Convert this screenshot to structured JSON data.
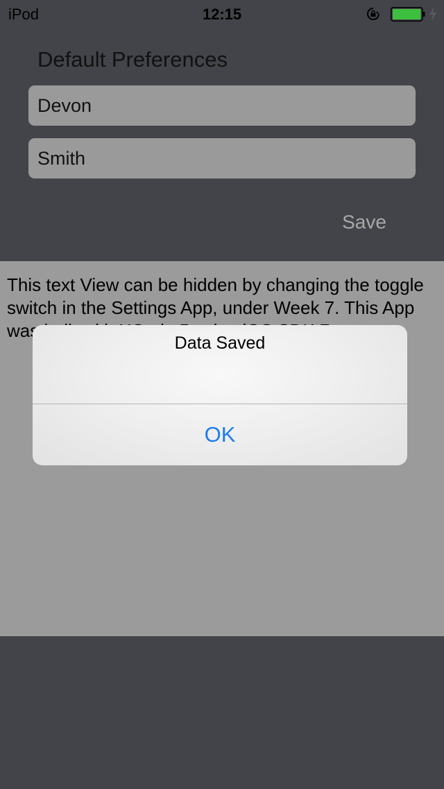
{
  "status_bar": {
    "carrier": "iPod",
    "time": "12:15",
    "battery_color": "#3fbf3f"
  },
  "prefs": {
    "title": "Default Preferences",
    "first_name_value": "Devon",
    "last_name_value": "Smith",
    "save_label": "Save"
  },
  "text_view": {
    "content": "This text View can be hidden by changing the toggle switch in the Settings App, under Week 7. This App was built with XCode 5 using iOS SDK 7."
  },
  "alert": {
    "title": "Data Saved",
    "ok_label": "OK"
  },
  "colors": {
    "background": "#434449",
    "field": "#9a9a9a",
    "text_view": "#9b9b9b",
    "accent": "#1b7cf0"
  }
}
